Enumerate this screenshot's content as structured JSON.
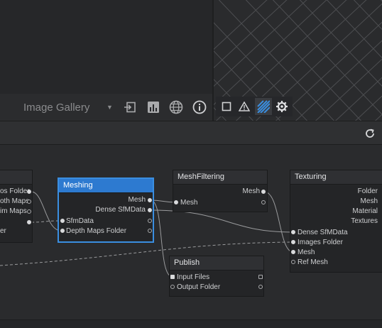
{
  "viewer": {
    "gallery_label": "Image Gallery"
  },
  "icons": {
    "gallery_caret": "chevron-down-icon",
    "import": "import-icon",
    "stats": "bar-chart-icon",
    "globe": "globe-icon",
    "info": "info-icon",
    "vp_square": "square-icon",
    "vp_warning": "warning-icon",
    "vp_hatch": "hatch-icon",
    "vp_settings": "gear-icon",
    "refresh": "refresh-icon"
  },
  "colors": {
    "accent": "#2d7ad0",
    "selected_border": "#3a8ee0"
  },
  "nodes": {
    "left": {
      "attrs": [
        "os Folder",
        "oth Maps",
        "im Maps",
        "",
        "er"
      ]
    },
    "meshing": {
      "title": "Meshing",
      "outputs": [
        "Mesh",
        "Dense SfMData"
      ],
      "inputs": [
        "SfmData",
        "Depth Maps Folder"
      ]
    },
    "meshfiltering": {
      "title": "MeshFiltering",
      "outputs": [
        "Mesh"
      ],
      "inputs": [
        "Mesh"
      ]
    },
    "publish": {
      "title": "Publish",
      "inputs": [
        "Input Files",
        "Output Folder"
      ]
    },
    "texturing": {
      "title": "Texturing",
      "outputs": [
        "Folder",
        "Mesh",
        "Material",
        "Textures"
      ],
      "inputs": [
        "Dense SfMData",
        "Images Folder",
        "Mesh",
        "Ref Mesh"
      ]
    }
  }
}
